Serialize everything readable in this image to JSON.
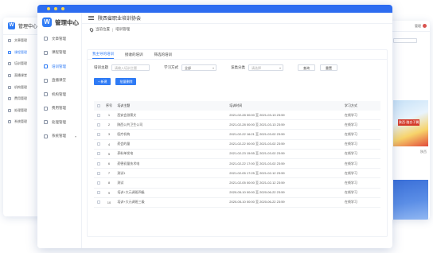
{
  "back_window": {
    "title": "管理中心",
    "items": [
      {
        "label": "文章管理",
        "active": false
      },
      {
        "label": "课程管理",
        "active": true
      },
      {
        "label": "培训管理",
        "active": false
      },
      {
        "label": "直播课堂",
        "active": false
      },
      {
        "label": "机构管理",
        "active": false
      },
      {
        "label": "费用管理",
        "active": false
      },
      {
        "label": "处理管理",
        "active": false
      },
      {
        "label": "系统管理",
        "active": false
      }
    ]
  },
  "app": {
    "logo_letter": "W",
    "title": "管理中心",
    "org_name": "陕西省职业培训协会",
    "accent_color": "#2f7bf5"
  },
  "sidebar": {
    "items": [
      {
        "label": "文章管理",
        "active": false,
        "icon": "article-icon"
      },
      {
        "label": "课程管理",
        "active": false,
        "icon": "course-icon"
      },
      {
        "label": "培训管理",
        "active": true,
        "icon": "training-icon"
      },
      {
        "label": "直播课堂",
        "active": false,
        "icon": "live-icon"
      },
      {
        "label": "机构管理",
        "active": false,
        "icon": "org-icon"
      },
      {
        "label": "费用管理",
        "active": false,
        "icon": "fee-icon"
      },
      {
        "label": "处理管理",
        "active": false,
        "icon": "handle-icon"
      },
      {
        "label": "系统管理",
        "active": false,
        "icon": "settings-icon",
        "has_submenu": true
      }
    ]
  },
  "breadcrumb": {
    "label": "当前位置",
    "sep": "|",
    "page": "培训管理"
  },
  "tabs": [
    {
      "label": "我主导的培训",
      "active": true
    },
    {
      "label": "接收的培训",
      "active": false
    },
    {
      "label": "筛选的培训",
      "active": false
    }
  ],
  "filters": {
    "topic_label": "培训主题",
    "topic_placeholder": "请输入培训主题",
    "mode_label": "学习方式",
    "mode_value": "全部",
    "category_label": "该类分类",
    "category_placeholder": "请选择",
    "search_label": "查询",
    "reset_label": "重置"
  },
  "actions": {
    "add_label": "+ 新建",
    "batch_delete_label": "批量删除"
  },
  "table": {
    "columns": [
      "序号",
      "培训主题",
      "培训时间",
      "学习方式"
    ],
    "rows": [
      {
        "no": "1",
        "topic": "西安会游第文",
        "time": "2021-02-28 00:00 至 2021-03-13 23:59",
        "mode": "在线学习"
      },
      {
        "no": "2",
        "topic": "陕西公共卫生公司",
        "time": "2021-02-28 00:00 至 2021-03-13 23:59",
        "mode": "在线学习"
      },
      {
        "no": "3",
        "topic": "医疗机构",
        "time": "2021-02-22 16:21 至 2021-03-02 23:59",
        "mode": "在线学习"
      },
      {
        "no": "4",
        "topic": "药会的量",
        "time": "2021-02-22 00:00 至 2021-03-02 23:59",
        "mode": "在线学习"
      },
      {
        "no": "5",
        "topic": "养料单发电",
        "time": "2021-02-23 15:55 至 2021-03-02 23:59",
        "mode": "在线学习"
      },
      {
        "no": "6",
        "topic": "药德初量技术电",
        "time": "2021-02-22 17:00 至 2021-03-02 23:59",
        "mode": "在线学习"
      },
      {
        "no": "7",
        "topic": "测试1",
        "time": "2021-02-05 17:25 至 2021-02-12 23:59",
        "mode": "在线学习"
      },
      {
        "no": "8",
        "topic": "测试",
        "time": "2021-02-05 00:00 至 2021-02-12 23:59",
        "mode": "在线学习"
      },
      {
        "no": "9",
        "topic": "培训+大元调班四级",
        "time": "2020-05-10 00:00 至 2020-06-22 23:59",
        "mode": "在线学习"
      },
      {
        "no": "10",
        "topic": "培训+大元调班三级",
        "time": "2020-05-10 00:00 至 2020-06-22 23:59",
        "mode": "在线学习"
      }
    ]
  },
  "right_window": {
    "top_text": "管理",
    "img1_tag": "陕西·融合子翼",
    "small_label_1": "陕西",
    "small_label_2": "陕西"
  }
}
